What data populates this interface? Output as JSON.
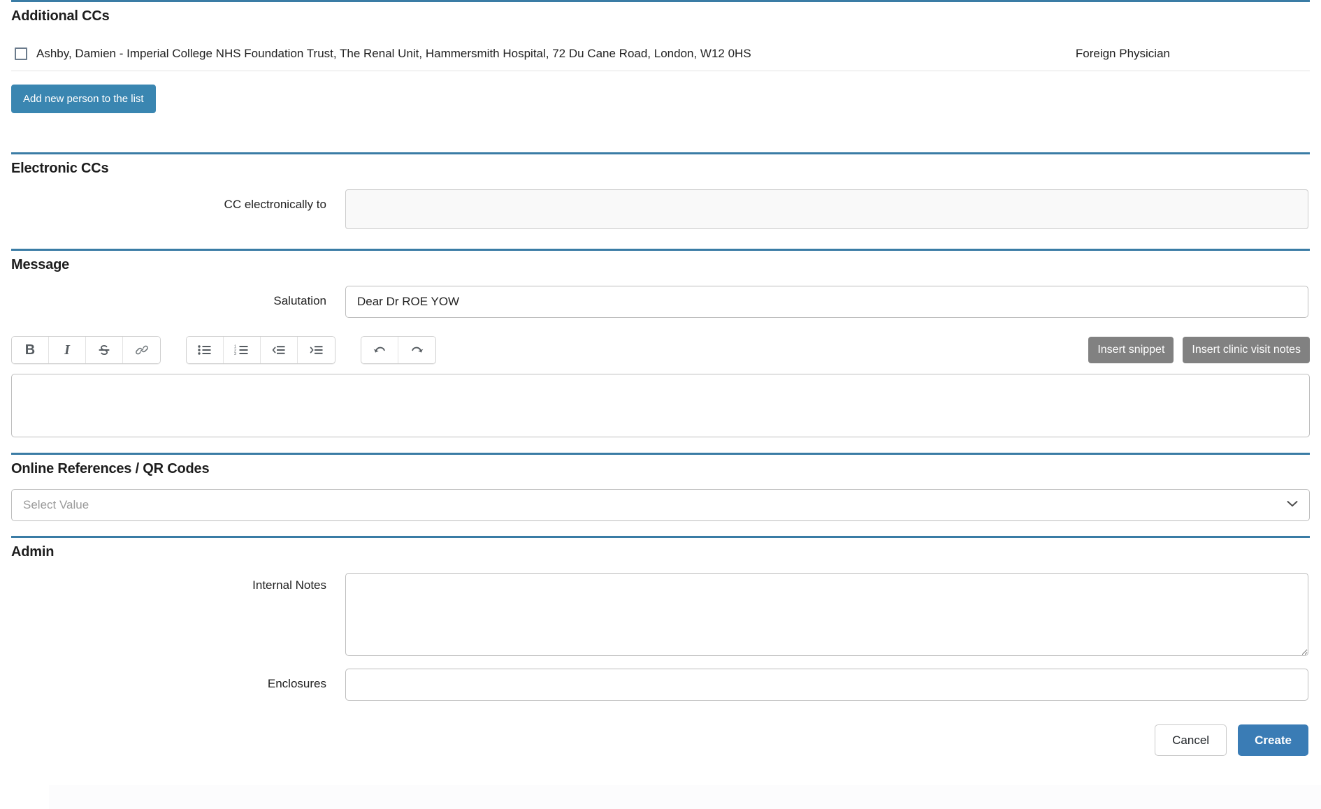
{
  "sections": {
    "additional_ccs": {
      "title": "Additional CCs",
      "cc_rows": [
        {
          "name": "Ashby, Damien - Imperial College NHS Foundation Trust, The Renal Unit, Hammersmith Hospital, 72 Du Cane Road, London, W12 0HS",
          "type": "Foreign Physician",
          "checked": false
        }
      ],
      "add_button": "Add new person to the list"
    },
    "electronic_ccs": {
      "title": "Electronic CCs",
      "cc_electronically_label": "CC electronically to",
      "cc_electronically_value": "",
      "cc_electronically_placeholder": ""
    },
    "message": {
      "title": "Message",
      "salutation_label": "Salutation",
      "salutation_value": "Dear Dr ROE YOW",
      "salutation_placeholder": "",
      "toolbar": {
        "groups": [
          {
            "name": "format",
            "buttons": [
              {
                "icon": "bold-icon",
                "label": "B"
              },
              {
                "icon": "italic-icon",
                "label": "I"
              },
              {
                "icon": "strikethrough-icon",
                "label": "S"
              },
              {
                "icon": "link-icon",
                "label": ""
              }
            ]
          },
          {
            "name": "lists",
            "buttons": [
              {
                "icon": "bullet-list-icon",
                "label": ""
              },
              {
                "icon": "numbered-list-icon",
                "label": ""
              },
              {
                "icon": "outdent-icon",
                "label": ""
              },
              {
                "icon": "indent-icon",
                "label": ""
              }
            ]
          },
          {
            "name": "history",
            "buttons": [
              {
                "icon": "undo-icon",
                "label": ""
              },
              {
                "icon": "redo-icon",
                "label": ""
              }
            ]
          }
        ],
        "insert_snippet": "Insert snippet",
        "insert_clinic_visit_notes": "Insert clinic visit notes"
      },
      "body_value": "",
      "body_placeholder": ""
    },
    "online_references": {
      "title": "Online References / QR Codes",
      "select_value": "Select Value",
      "select_options": [
        "Select Value"
      ]
    },
    "admin": {
      "title": "Admin",
      "internal_notes_label": "Internal Notes",
      "internal_notes_value": "",
      "internal_notes_placeholder": "",
      "enclosures_label": "Enclosures",
      "enclosures_value": "",
      "enclosures_placeholder": ""
    }
  },
  "footer": {
    "cancel_label": "Cancel",
    "create_label": "Create"
  },
  "colors": {
    "divider_blue": "#3a7ca5",
    "primary_blue": "#3a86b1",
    "create_blue": "#3a7cb5",
    "gray_button": "#818181",
    "readonly_bg": "#f9f9f9",
    "border_gray": "#bdbdbd",
    "placeholder_gray": "#9a9a9a"
  }
}
